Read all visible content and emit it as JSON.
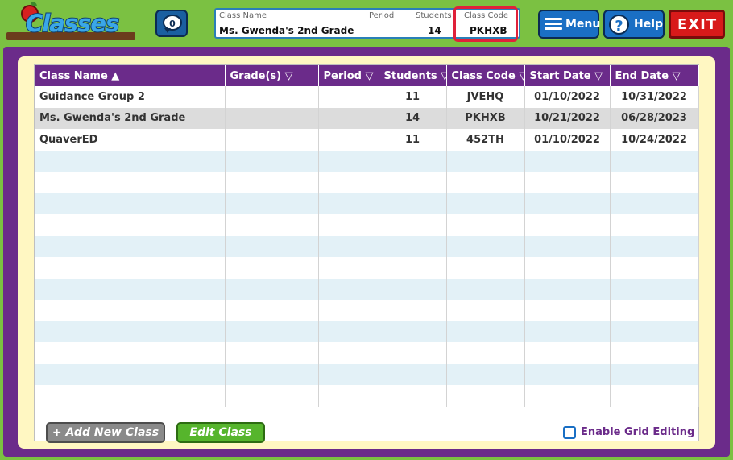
{
  "header": {
    "logo_text": "Classes",
    "message_count": "0",
    "class_info": {
      "class_name_label": "Class Name",
      "class_name": "Ms. Gwenda's 2nd Grade",
      "period_label": "Period",
      "period": "",
      "students_label": "Students",
      "students": "14",
      "class_code_label": "Class Code",
      "class_code": "PKHXB"
    },
    "menu_label": "Menu",
    "help_label": "Help",
    "exit_label": "EXIT"
  },
  "table": {
    "columns": [
      "Class Name ▲",
      "Grade(s) ▽",
      "Period ▽",
      "Students ▽",
      "Class Code ▽",
      "Start Date ▽",
      "End Date ▽"
    ],
    "rows": [
      {
        "name": "Guidance Group 2",
        "grades": "",
        "period": "",
        "students": "11",
        "code": "JVEHQ",
        "start": "01/10/2022",
        "end": "10/31/2022"
      },
      {
        "name": "Ms. Gwenda's 2nd Grade",
        "grades": "",
        "period": "",
        "students": "14",
        "code": "PKHXB",
        "start": "10/21/2022",
        "end": "06/28/2023"
      },
      {
        "name": "QuaverED",
        "grades": "",
        "period": "",
        "students": "11",
        "code": "452TH",
        "start": "01/10/2022",
        "end": "10/24/2022"
      }
    ]
  },
  "footer": {
    "add_label": "+ Add New Class",
    "edit_label": "Edit Class",
    "grid_editing_label": "Enable Grid Editing"
  },
  "colors": {
    "header_green": "#7bc142",
    "panel_purple": "#6b2b8a",
    "inner_yellow": "#fff7c2",
    "highlight_red": "#e0213a",
    "button_blue": "#1a6fc4"
  }
}
